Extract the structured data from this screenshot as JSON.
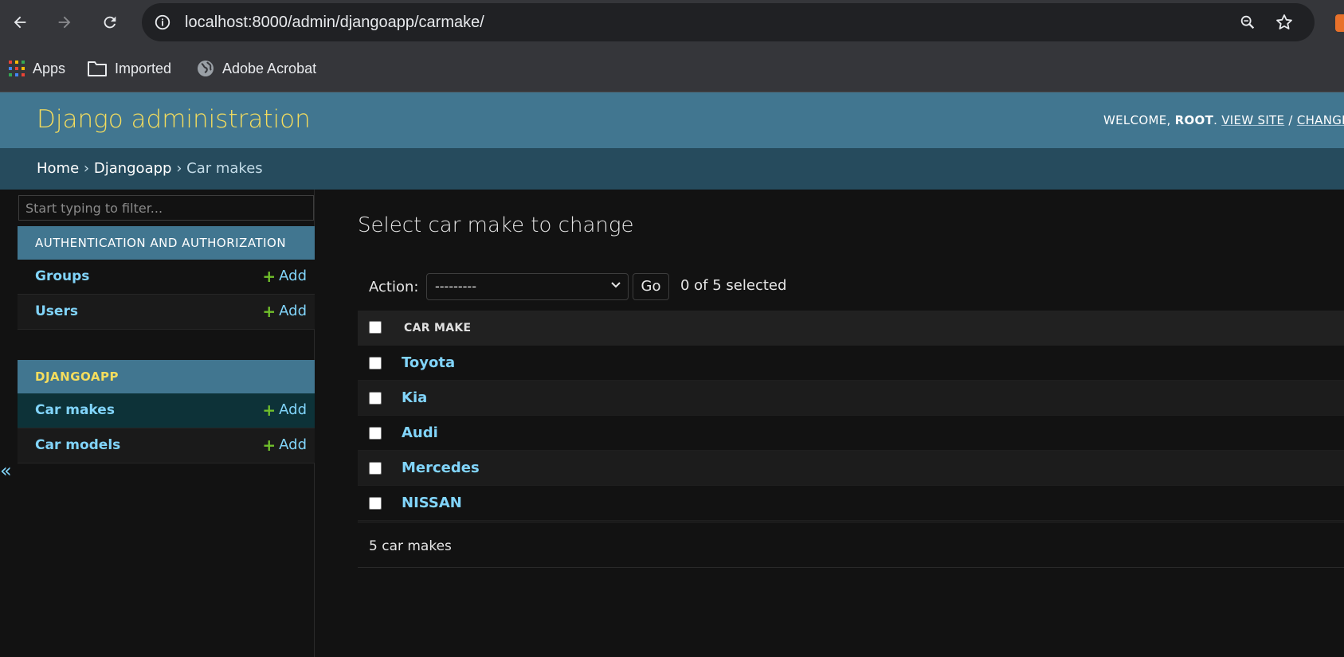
{
  "browser": {
    "url_host": "localhost",
    "url_path": ":8000/admin/djangoapp/carmake/",
    "bookmarks": [
      "Apps",
      "Imported",
      "Adobe Acrobat"
    ]
  },
  "header": {
    "site_title": "Django administration",
    "welcome": "WELCOME, ",
    "username": "ROOT",
    "view_site": "VIEW SITE",
    "change_password": "CHANGE PAS"
  },
  "breadcrumbs": {
    "home": "Home",
    "app": "Djangoapp",
    "current": "Car makes",
    "separator": "›"
  },
  "sidebar": {
    "filter_placeholder": "Start typing to filter...",
    "auth_caption": "AUTHENTICATION AND AUTHORIZATION",
    "auth_items": [
      {
        "label": "Groups",
        "add": "Add"
      },
      {
        "label": "Users",
        "add": "Add"
      }
    ],
    "app_caption": "DJANGOAPP",
    "app_items": [
      {
        "label": "Car makes",
        "add": "Add"
      },
      {
        "label": "Car models",
        "add": "Add"
      }
    ],
    "collapse_glyph": "«"
  },
  "content": {
    "title": "Select car make to change",
    "action_label": "Action:",
    "action_value": "---------",
    "go_label": "Go",
    "selected_counter": "0 of 5 selected",
    "column_header": "CAR MAKE",
    "rows": [
      "Toyota",
      "Kia",
      "Audi",
      "Mercedes",
      "NISSAN"
    ],
    "result_count": "5 car makes"
  },
  "colors": {
    "header_bg": "#417690",
    "breadcrumb_bg": "#264b5d",
    "title_yellow": "#f5dd5d",
    "link_blue": "#81d4fa",
    "add_green": "#70bf2b",
    "page_bg": "#121212"
  }
}
